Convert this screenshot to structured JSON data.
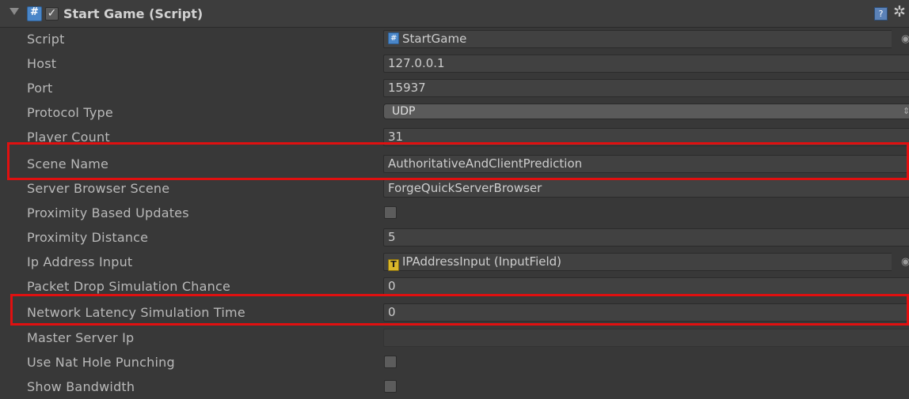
{
  "component": {
    "title": "Start Game (Script)",
    "enabled_glyph": "✓",
    "icons": {
      "fold": "foldout-arrow-icon",
      "script": "csharp-script-icon",
      "help": "help-book-icon",
      "settings": "gear-icon"
    },
    "help_glyph": "?",
    "gear_glyph": "✲"
  },
  "fields": [
    {
      "label": "Script",
      "type": "object",
      "value": "StartGame",
      "icon": "script-icon"
    },
    {
      "label": "Host",
      "type": "text",
      "value": "127.0.0.1"
    },
    {
      "label": "Port",
      "type": "text",
      "value": "15937"
    },
    {
      "label": "Protocol Type",
      "type": "dropdown",
      "value": "UDP"
    },
    {
      "label": "Player Count",
      "type": "text",
      "value": "31"
    },
    {
      "label": "Scene Name",
      "type": "text",
      "value": "AuthoritativeAndClientPrediction",
      "highlighted": true
    },
    {
      "label": "Server Browser Scene",
      "type": "text",
      "value": "ForgeQuickServerBrowser"
    },
    {
      "label": "Proximity Based Updates",
      "type": "checkbox",
      "checked": false
    },
    {
      "label": "Proximity Distance",
      "type": "text",
      "value": "5"
    },
    {
      "label": "Ip Address Input",
      "type": "object",
      "value": "IPAddressInput (InputField)",
      "icon": "text-icon",
      "icon_glyph": "T"
    },
    {
      "label": "Packet Drop Simulation Chance",
      "type": "text",
      "value": "0"
    },
    {
      "label": "Network Latency Simulation Time",
      "type": "text",
      "value": "0",
      "highlighted": true
    },
    {
      "label": "Master Server Ip",
      "type": "text",
      "value": ""
    },
    {
      "label": "Use Nat Hole Punching",
      "type": "checkbox",
      "checked": false
    },
    {
      "label": "Show Bandwidth",
      "type": "checkbox",
      "checked": false
    }
  ],
  "colors": {
    "highlight": "#e01010",
    "background": "#383838"
  }
}
